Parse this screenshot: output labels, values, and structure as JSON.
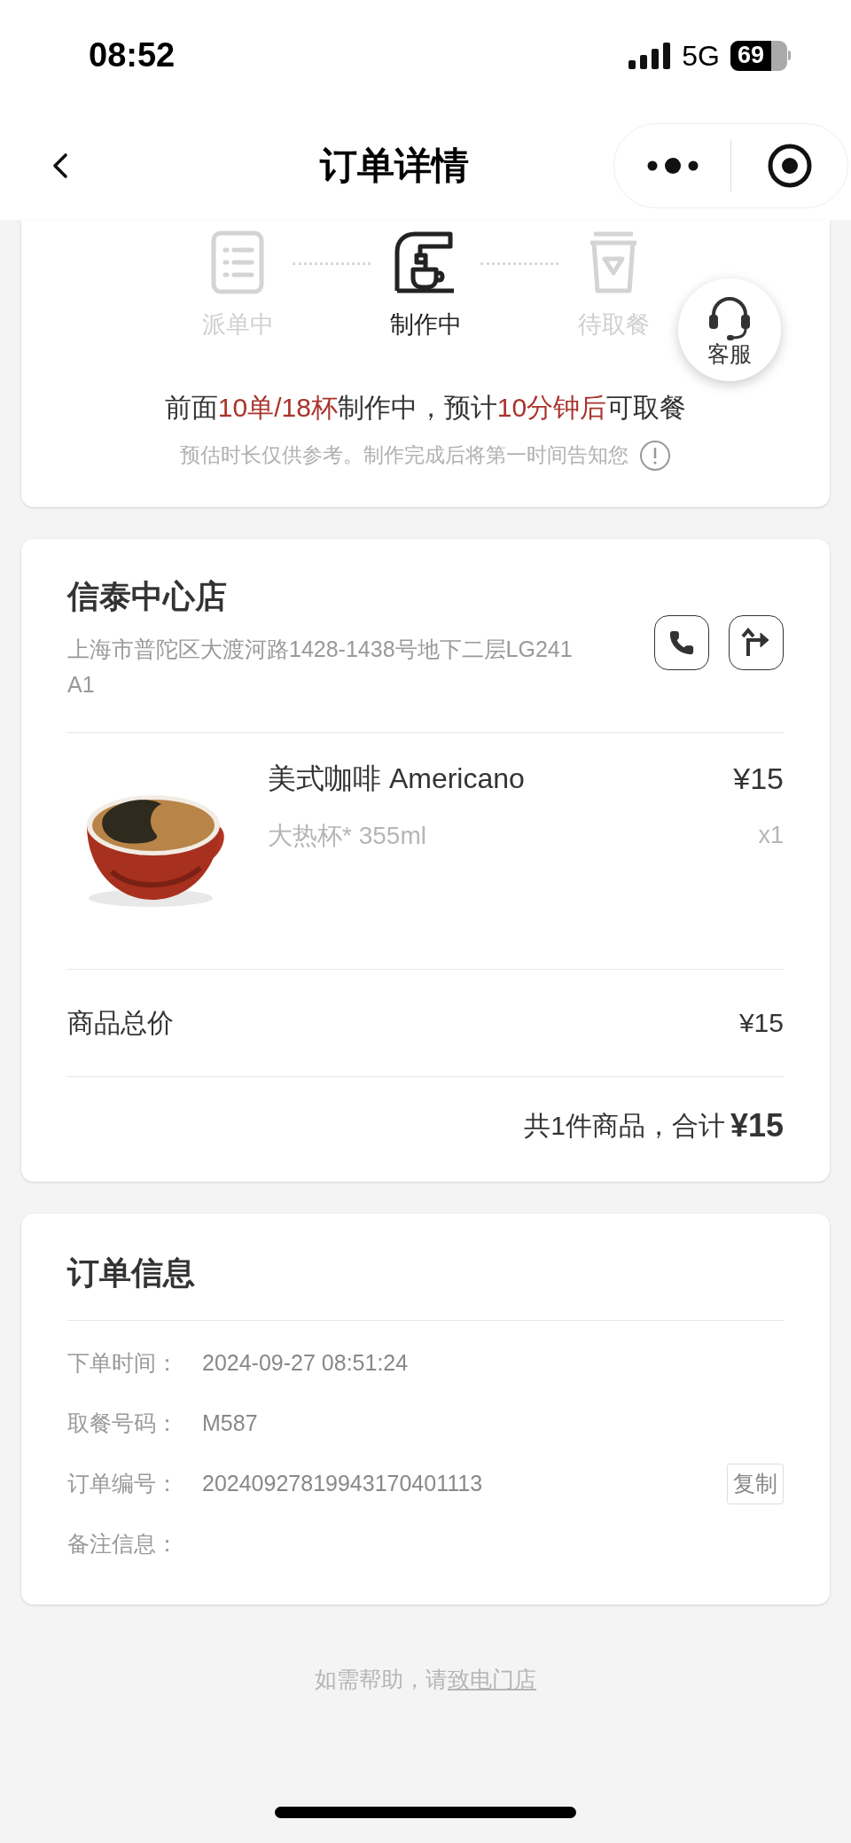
{
  "status_bar": {
    "time": "08:52",
    "network": "5G",
    "battery": "69"
  },
  "nav": {
    "title": "订单详情"
  },
  "progress": {
    "steps": [
      {
        "kind": "list",
        "label": "派单中",
        "active": false
      },
      {
        "kind": "machine",
        "label": "制作中",
        "active": true
      },
      {
        "kind": "cup",
        "label": "待取餐",
        "active": false
      }
    ],
    "service_label": "客服",
    "estimate": [
      {
        "text": "前面",
        "highlight": false
      },
      {
        "text": "10单/18杯",
        "highlight": true
      },
      {
        "text": "制作中，预计",
        "highlight": false
      },
      {
        "text": "10分钟后",
        "highlight": true
      },
      {
        "text": "可取餐",
        "highlight": false
      }
    ],
    "note": "预估时长仅供参考。制作完成后将第一时间告知您"
  },
  "store": {
    "name": "信泰中心店",
    "address": "上海市普陀区大渡河路1428-1438号地下二层LG241A1",
    "items": [
      {
        "name": "美式咖啡 Americano",
        "price": "¥15",
        "spec": "大热杯* 355ml",
        "qty": "x1"
      }
    ],
    "subtotal_label": "商品总价",
    "subtotal": "¥15",
    "total_prefix": "共1件商品，合计",
    "total": "¥15"
  },
  "order_info": {
    "title": "订单信息",
    "rows": [
      {
        "label": "下单时间：",
        "value": "2024-09-27 08:51:24"
      },
      {
        "label": "取餐号码：",
        "value": "M587"
      },
      {
        "label": "订单编号：",
        "value": "20240927819943170401113",
        "action": "复制"
      },
      {
        "label": "备注信息："
      }
    ]
  },
  "footer": {
    "text": "如需帮助，请",
    "link": "致电门店"
  }
}
